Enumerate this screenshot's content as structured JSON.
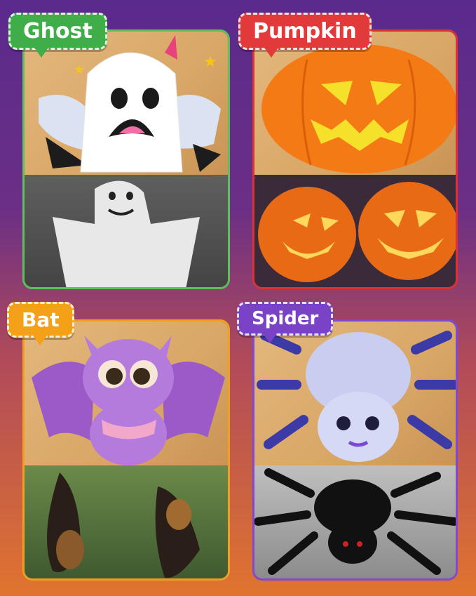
{
  "cards": [
    {
      "label": "Ghost",
      "color": "#3fae49",
      "border": "#5cc15a"
    },
    {
      "label": "Pumpkin",
      "color": "#e23a3a",
      "border": "#d93434"
    },
    {
      "label": "Bat",
      "color": "#f5a019",
      "border": "#f0a020"
    },
    {
      "label": "Spider",
      "color": "#7a42c6",
      "border": "#7d4ad0"
    }
  ]
}
